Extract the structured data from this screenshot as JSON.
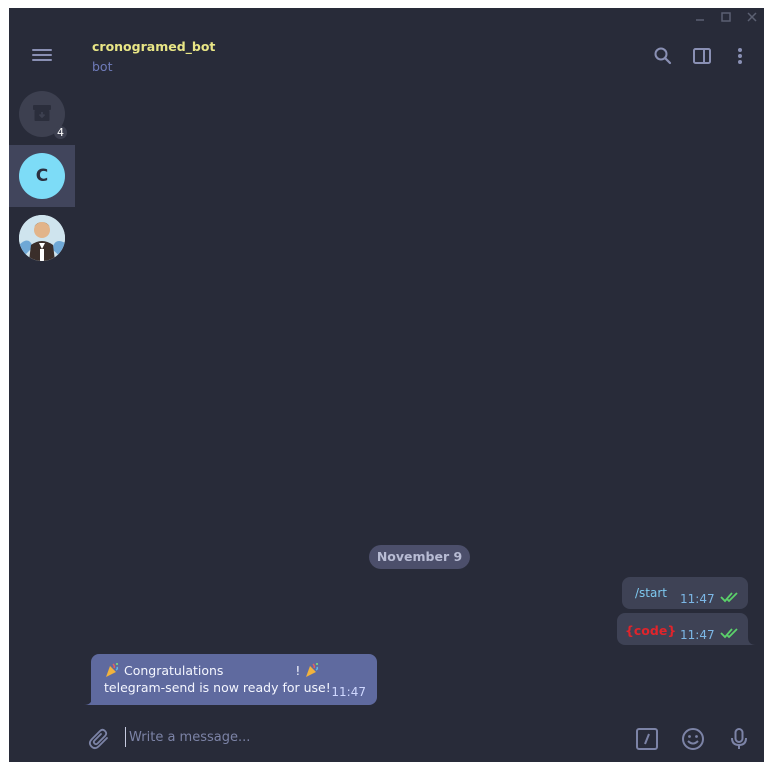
{
  "window": {
    "controls": [
      "minimize",
      "maximize",
      "close"
    ]
  },
  "sidebar": {
    "menu_icon": "hamburger-icon",
    "archive": {
      "icon": "archive-icon",
      "count": "4"
    },
    "chats": [
      {
        "initial": "C",
        "color": "#7ddcf7",
        "active": true
      },
      {
        "initial": "",
        "icon": "photo-avatar",
        "active": false
      }
    ]
  },
  "header": {
    "title": "cronogramed_bot",
    "subtitle": "bot",
    "icons": [
      "search-icon",
      "sidebar-toggle-icon",
      "more-vertical-icon"
    ]
  },
  "messages": {
    "date": "November 9",
    "outgoing": [
      {
        "text": "/start",
        "time": "11:47",
        "status": "read"
      },
      {
        "text": "{code}",
        "time": "11:47",
        "status": "read"
      }
    ],
    "incoming": {
      "line1_before": "Congratulations",
      "line1_after": "!",
      "line2": "telegram-send is now ready for use!",
      "time": "11:47"
    }
  },
  "composer": {
    "placeholder": "Write a message...",
    "icons": [
      "paperclip-icon",
      "bot-command-icon",
      "emoji-icon",
      "microphone-icon"
    ]
  },
  "colors": {
    "background": "#282b39",
    "title": "#e9e686",
    "incoming_bubble": "#5f6a9f",
    "outgoing_bubble": "#3e4255",
    "read_ticks": "#5bd16a"
  }
}
